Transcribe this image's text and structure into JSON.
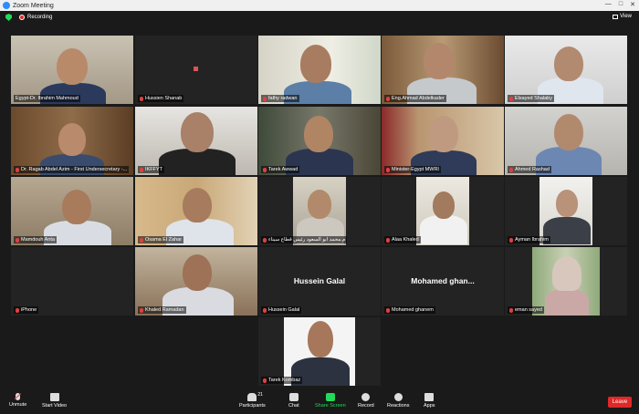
{
  "window": {
    "title": "Zoom Meeting"
  },
  "topbar": {
    "recording_label": "Recording",
    "view_label": "View"
  },
  "participants": [
    {
      "name": "Egypt-Dr. Ibrahim Mahmoud",
      "active": true,
      "video": true
    },
    {
      "name": "Hussien Shanab",
      "video": false
    },
    {
      "name": "fathy radwan",
      "video": true
    },
    {
      "name": "Eng.Ahmad Abdelkader",
      "video": true
    },
    {
      "name": "Elsayed Shalaby",
      "video": true
    },
    {
      "name": "Dr. Ragab Abdel Azim - First Undersecretary -...",
      "video": true
    },
    {
      "name": "IKFFYT",
      "video": true
    },
    {
      "name": "Tarek Awwad",
      "video": true
    },
    {
      "name": "Minister-Egypt MWRI",
      "video": true
    },
    {
      "name": "Ahmed Rashad",
      "video": true
    },
    {
      "name": "Mamdouh Anta",
      "video": true
    },
    {
      "name": "Osama El Zahar",
      "video": true
    },
    {
      "name": "م.محمد ابو السعود رئيس قطاع سيناء",
      "video": true
    },
    {
      "name": "Alaa Khaled",
      "video": true
    },
    {
      "name": "Ayman Ibrahim",
      "video": true
    },
    {
      "name": "iPhone",
      "video": false
    },
    {
      "name": "Khaled Ramadan",
      "video": true
    },
    {
      "name": "Hussein Galal",
      "video": false,
      "display_name": "Hussein Galal"
    },
    {
      "name": "Mohamed ghanem",
      "video": false,
      "display_name": "Mohamed  ghan..."
    },
    {
      "name": "eman sayed",
      "video": true
    },
    {
      "name": "Tarek Kombaz",
      "video": true
    }
  ],
  "controls": {
    "unmute": "Unmute",
    "start_video": "Start Video",
    "participants": "Participants",
    "participants_count": "21",
    "chat": "Chat",
    "share_screen": "Share Screen",
    "record": "Record",
    "reactions": "Reactions",
    "apps": "Apps",
    "leave": "Leave"
  },
  "colors": {
    "active_speaker": "#c5e84f",
    "share_green": "#23d959",
    "leave_red": "#e02828",
    "muted_red": "#e04040"
  }
}
